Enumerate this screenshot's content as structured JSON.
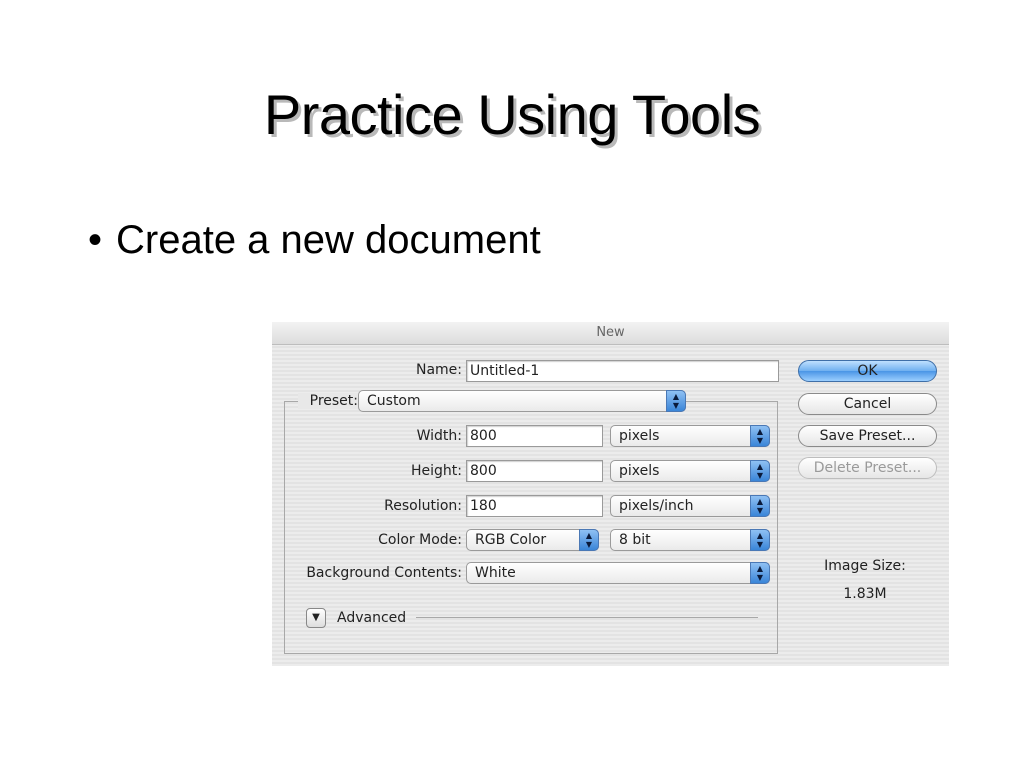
{
  "slide": {
    "title": "Practice Using Tools",
    "bullet": "Create a new document"
  },
  "dialog": {
    "title": "New",
    "name_label": "Name:",
    "name_value": "Untitled-1",
    "preset_label": "Preset:",
    "preset_value": "Custom",
    "width_label": "Width:",
    "width_value": "800",
    "width_unit": "pixels",
    "height_label": "Height:",
    "height_value": "800",
    "height_unit": "pixels",
    "resolution_label": "Resolution:",
    "resolution_value": "180",
    "resolution_unit": "pixels/inch",
    "color_mode_label": "Color Mode:",
    "color_mode_value": "RGB Color",
    "bit_depth_value": "8 bit",
    "background_label": "Background Contents:",
    "background_value": "White",
    "advanced_label": "Advanced",
    "buttons": {
      "ok": "OK",
      "cancel": "Cancel",
      "save_preset": "Save Preset...",
      "delete_preset": "Delete Preset..."
    },
    "image_size_label": "Image Size:",
    "image_size_value": "1.83M"
  }
}
